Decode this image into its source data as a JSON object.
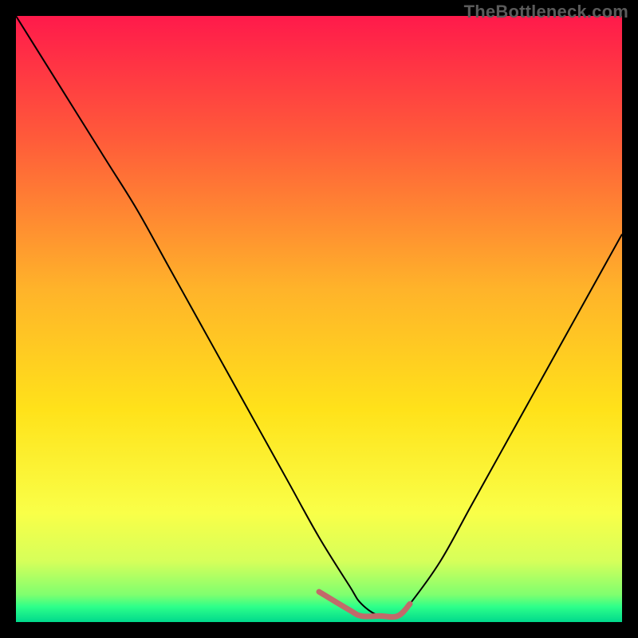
{
  "watermark": "TheBottleneck.com",
  "chart_data": {
    "type": "line",
    "title": "",
    "xlabel": "",
    "ylabel": "",
    "xlim": [
      0,
      100
    ],
    "ylim": [
      0,
      100
    ],
    "grid": false,
    "series": [
      {
        "name": "curve",
        "stroke": "#000000",
        "stroke_width": 2,
        "x": [
          0,
          5,
          10,
          15,
          20,
          25,
          30,
          35,
          40,
          45,
          50,
          55,
          57,
          60,
          63,
          65,
          70,
          75,
          80,
          85,
          90,
          95,
          100
        ],
        "values": [
          100,
          92,
          84,
          76,
          68,
          59,
          50,
          41,
          32,
          23,
          14,
          6,
          3,
          1,
          1,
          3,
          10,
          19,
          28,
          37,
          46,
          55,
          64
        ]
      },
      {
        "name": "highlight",
        "stroke": "#c26a6a",
        "stroke_width": 7,
        "x": [
          50,
          55,
          57,
          60,
          63,
          65
        ],
        "values": [
          5,
          2,
          1,
          1,
          1,
          3
        ]
      }
    ],
    "gradient_stops": [
      {
        "offset": 0.0,
        "color": "#ff1a4b"
      },
      {
        "offset": 0.2,
        "color": "#ff5a3a"
      },
      {
        "offset": 0.45,
        "color": "#ffb32a"
      },
      {
        "offset": 0.65,
        "color": "#ffe21a"
      },
      {
        "offset": 0.82,
        "color": "#f9ff48"
      },
      {
        "offset": 0.9,
        "color": "#d6ff5a"
      },
      {
        "offset": 0.955,
        "color": "#7fff6f"
      },
      {
        "offset": 0.975,
        "color": "#2dff8a"
      },
      {
        "offset": 1.0,
        "color": "#00d98c"
      }
    ]
  }
}
